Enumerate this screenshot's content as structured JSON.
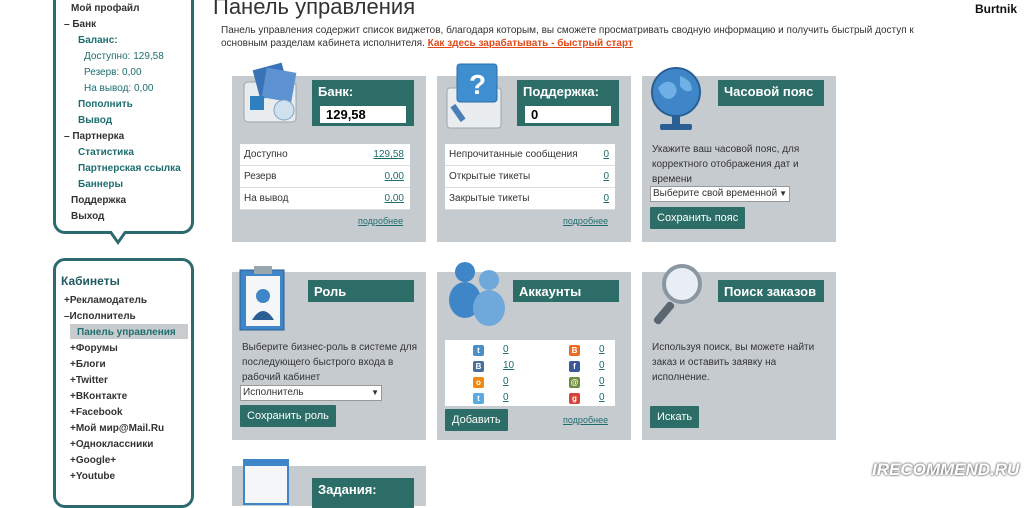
{
  "header": {
    "title": "Панель управления",
    "user": "Burtnik",
    "intro": "Панель управления содержит список виджетов, благодаря которым, вы сможете просматривать сводную информацию и получить быстрый доступ к основным разделам кабинета исполнителя.",
    "quickstart_link": "Как здесь зарабатывать - быстрый старт"
  },
  "menu1": [
    {
      "label": "Мой профайл",
      "style": "nb"
    },
    {
      "label": "Банк",
      "style": "nb",
      "prefix": "–"
    },
    {
      "label": "Баланс:",
      "style": "nt"
    },
    {
      "label": "Доступно: 129,58",
      "style": "nv"
    },
    {
      "label": "Резерв: 0,00",
      "style": "nv"
    },
    {
      "label": "На вывод: 0,00",
      "style": "nv"
    },
    {
      "label": "Пополнить",
      "style": "nt"
    },
    {
      "label": "Вывод",
      "style": "nt"
    },
    {
      "label": "Партнерка",
      "style": "nb",
      "prefix": "–"
    },
    {
      "label": "Статистика",
      "style": "nt"
    },
    {
      "label": "Партнерская ссылка",
      "style": "nt"
    },
    {
      "label": "Баннеры",
      "style": "nt"
    },
    {
      "label": "Поддержка",
      "style": "nb"
    },
    {
      "label": "Выход",
      "style": "nb"
    }
  ],
  "cabinets": {
    "title": "Кабинеты",
    "items": [
      {
        "label": "Рекламодатель",
        "prefix": "+"
      },
      {
        "label": "Исполнитель",
        "prefix": "–"
      },
      {
        "label": "Панель управления",
        "prefix": ""
      },
      {
        "label": "Форумы",
        "prefix": "+"
      },
      {
        "label": "Блоги",
        "prefix": "+"
      },
      {
        "label": "Twitter",
        "prefix": "+"
      },
      {
        "label": "ВКонтакте",
        "prefix": "+"
      },
      {
        "label": "Facebook",
        "prefix": "+"
      },
      {
        "label": "Мой мир@Mail.Ru",
        "prefix": "+"
      },
      {
        "label": "Одноклассники",
        "prefix": "+"
      },
      {
        "label": "Google+",
        "prefix": "+"
      },
      {
        "label": "Youtube",
        "prefix": "+"
      }
    ]
  },
  "bank": {
    "title": "Банк:",
    "value": "129,58",
    "rows": [
      {
        "k": "Доступно",
        "v": "129,58"
      },
      {
        "k": "Резерв",
        "v": "0,00"
      },
      {
        "k": "На вывод",
        "v": "0,00"
      }
    ],
    "more": "подробнее"
  },
  "support": {
    "title": "Поддержка:",
    "value": "0",
    "rows": [
      {
        "k": "Непрочитанные сообщения",
        "v": "0"
      },
      {
        "k": "Открытые тикеты",
        "v": "0"
      },
      {
        "k": "Закрытые тикеты",
        "v": "0"
      }
    ],
    "more": "подробнее"
  },
  "timezone": {
    "title": "Часовой пояс",
    "desc": "Укажите ваш часовой пояс, для корректного отображения дат и времени",
    "select": "Выберите свой временной",
    "button": "Сохранить пояс"
  },
  "role": {
    "title": "Роль",
    "desc": "Выберите бизнес-роль в системе для последующего быстрого входа в рабочий кабинет",
    "select": "Исполнитель",
    "button": "Сохранить роль"
  },
  "accounts": {
    "title": "Аккаунты",
    "button": "Добавить",
    "more": "подробнее",
    "left": [
      {
        "icon": "twitter-icon",
        "color": "#4a8fc7",
        "glyph": "t",
        "v": "0"
      },
      {
        "icon": "vk-icon",
        "color": "#4a6f9c",
        "glyph": "B",
        "v": "10"
      },
      {
        "icon": "odnoklassniki-icon",
        "color": "#ee8a14",
        "glyph": "o",
        "v": "0"
      },
      {
        "icon": "twitter-bird-icon",
        "color": "#5aa9e0",
        "glyph": "t",
        "v": "0"
      }
    ],
    "right": [
      {
        "icon": "blogger-icon",
        "color": "#f06a1d",
        "glyph": "B",
        "v": "0"
      },
      {
        "icon": "facebook-icon",
        "color": "#3b5998",
        "glyph": "f",
        "v": "0"
      },
      {
        "icon": "mailru-icon",
        "color": "#6f8d3b",
        "glyph": "@",
        "v": "0"
      },
      {
        "icon": "google-icon",
        "color": "#d7433a",
        "glyph": "g",
        "v": "0"
      }
    ]
  },
  "search": {
    "title": "Поиск заказов",
    "desc": "Используя поиск, вы можете найти заказ и оставить заявку на исполнение.",
    "button": "Искать"
  },
  "tasks": {
    "title": "Задания:"
  },
  "watermark": "IRECOMMEND.RU"
}
